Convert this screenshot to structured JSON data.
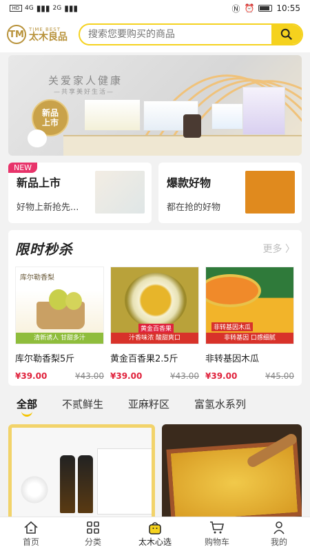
{
  "status_bar": {
    "time": "10:55",
    "hd": "HD",
    "network": "4G",
    "network2": "2G"
  },
  "header": {
    "logo_en": "TIME BEST",
    "logo_cn": "太木良品",
    "logo_mark": "TM",
    "search_placeholder": "搜索您要购买的商品"
  },
  "banner": {
    "title": "关爱家人健康",
    "subtitle": "—共享美好生活—",
    "badge_line1": "新品",
    "badge_line2": "上市"
  },
  "promos": [
    {
      "tag": "NEW",
      "title": "新品上市",
      "desc": "好物上新抢先..."
    },
    {
      "title": "爆款好物",
      "desc": "都在抢的好物"
    }
  ],
  "flash_sale": {
    "title": "限时秒杀",
    "more": "更多 〉",
    "items": [
      {
        "name": "库尔勒香梨5斤",
        "price": "¥39.00",
        "old_price": "¥43.00",
        "img_label": "库尔勒香梨",
        "img_banner": "清新诱人 甘甜多汁"
      },
      {
        "name": "黄金百香果2.5斤",
        "price": "¥39.00",
        "old_price": "¥43.00",
        "img_label": "黄金百香果",
        "img_banner": "汁香味浓 酸甜爽口"
      },
      {
        "name": "非转基因木瓜",
        "price": "¥39.00",
        "old_price": "¥45.00",
        "img_label": "非转基因木瓜",
        "img_banner": "非转基因 口感细腻"
      }
    ]
  },
  "category_tabs": [
    "全部",
    "不贰鲜生",
    "亚麻籽区",
    "富氢水系列"
  ],
  "bottom_nav": [
    {
      "label": "首页",
      "icon": "home-icon"
    },
    {
      "label": "分类",
      "icon": "grid-icon"
    },
    {
      "label": "太木心选",
      "icon": "bag-icon"
    },
    {
      "label": "购物车",
      "icon": "cart-icon"
    },
    {
      "label": "我的",
      "icon": "user-icon"
    }
  ],
  "colors": {
    "accent": "#f5d21e",
    "price": "#e0223c",
    "brand": "#b8923a",
    "new_tag": "#e8336a"
  }
}
